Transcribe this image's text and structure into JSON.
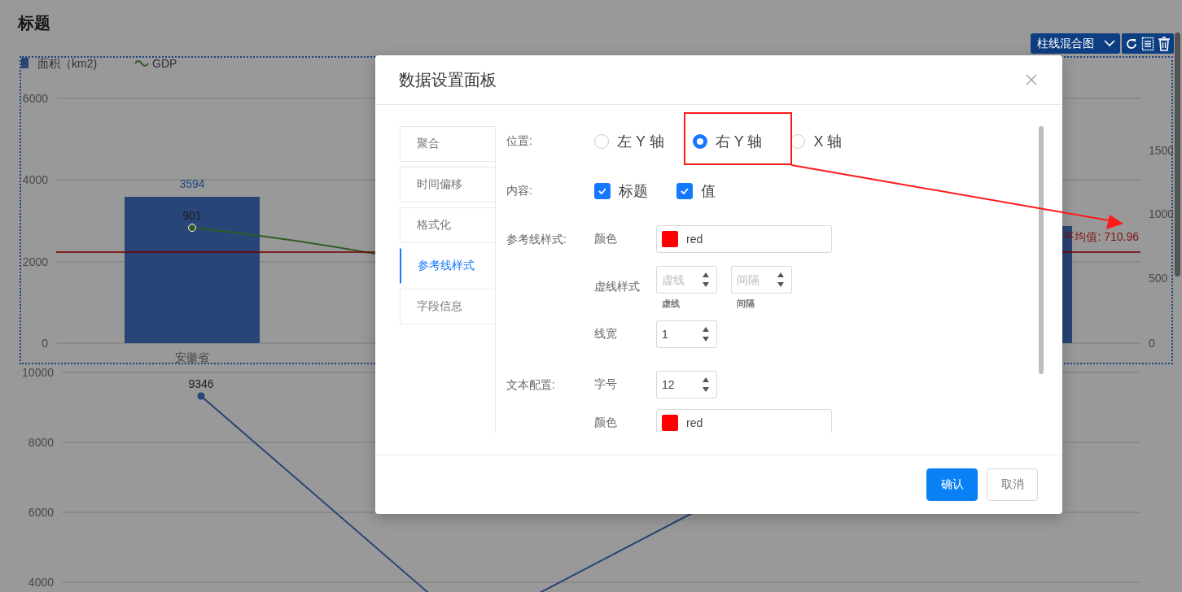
{
  "page": {
    "title": "标题"
  },
  "toolbar": {
    "chart_type": "柱线混合图"
  },
  "chart_top": {
    "legend": [
      {
        "label": "面积（km2)",
        "color": "#294476",
        "kind": "bar"
      },
      {
        "label": "GDP",
        "color": "#2f5c26",
        "kind": "line"
      }
    ],
    "left_axis_ticks": [
      "6000",
      "4000",
      "2000",
      "0"
    ],
    "right_axis_ticks": [
      "1500",
      "1000",
      "500",
      "0"
    ],
    "bar_label": "3594",
    "point_label": "901",
    "category": "安徽省",
    "reference_line": {
      "label": "平均值: 710.96"
    }
  },
  "chart_bottom": {
    "left_axis_ticks": [
      "10000",
      "8000",
      "6000",
      "4000"
    ],
    "point_label": "9346"
  },
  "dialog": {
    "title": "数据设置面板",
    "tabs": [
      {
        "label": "聚合",
        "selected": false
      },
      {
        "label": "时间偏移",
        "selected": false
      },
      {
        "label": "格式化",
        "selected": false
      },
      {
        "label": "参考线样式",
        "selected": true
      },
      {
        "label": "字段信息",
        "selected": false
      }
    ],
    "position": {
      "label": "位置:",
      "options": [
        {
          "label": "左 Y 轴",
          "selected": false
        },
        {
          "label": "右 Y 轴",
          "selected": true
        },
        {
          "label": "X 轴",
          "selected": false
        }
      ]
    },
    "content": {
      "label": "内容:",
      "options": [
        {
          "label": "标题",
          "checked": true
        },
        {
          "label": "值",
          "checked": true
        }
      ]
    },
    "line_style": {
      "label": "参考线样式:",
      "color": {
        "label": "颜色",
        "value": "red",
        "color": "#ff0000"
      },
      "dash": {
        "label": "虚线样式",
        "fields": [
          {
            "placeholder": "虚线",
            "caption": "虚线"
          },
          {
            "placeholder": "间隔",
            "caption": "间隔"
          }
        ]
      },
      "width": {
        "label": "线宽",
        "value": "1"
      }
    },
    "text_config": {
      "label": "文本配置:",
      "size": {
        "label": "字号",
        "value": "12"
      },
      "color": {
        "label": "颜色",
        "value": "red",
        "color": "#ff0000"
      }
    },
    "buttons": [
      {
        "label": "确认",
        "kind": "primary"
      },
      {
        "label": "取消",
        "kind": "default"
      }
    ]
  }
}
